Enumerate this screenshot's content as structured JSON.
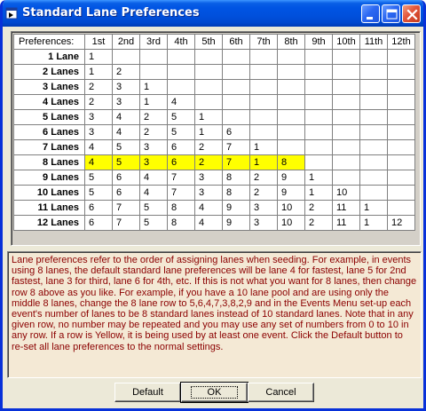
{
  "window": {
    "title": "Standard Lane Preferences",
    "controls": [
      "minimize-icon",
      "maximize-icon",
      "close-icon"
    ]
  },
  "grid": {
    "corner_label": "Preferences:",
    "columns": [
      "1st",
      "2nd",
      "3rd",
      "4th",
      "5th",
      "6th",
      "7th",
      "8th",
      "9th",
      "10th",
      "11th",
      "12th"
    ],
    "highlight_color": "#ffff00",
    "rows": [
      {
        "label": "1 Lane",
        "values": [
          "1"
        ]
      },
      {
        "label": "2 Lanes",
        "values": [
          "1",
          "2"
        ]
      },
      {
        "label": "3 Lanes",
        "values": [
          "2",
          "3",
          "1"
        ]
      },
      {
        "label": "4 Lanes",
        "values": [
          "2",
          "3",
          "1",
          "4"
        ]
      },
      {
        "label": "5 Lanes",
        "values": [
          "3",
          "4",
          "2",
          "5",
          "1"
        ]
      },
      {
        "label": "6 Lanes",
        "values": [
          "3",
          "4",
          "2",
          "5",
          "1",
          "6"
        ]
      },
      {
        "label": "7 Lanes",
        "values": [
          "4",
          "5",
          "3",
          "6",
          "2",
          "7",
          "1"
        ]
      },
      {
        "label": "8 Lanes",
        "values": [
          "4",
          "5",
          "3",
          "6",
          "2",
          "7",
          "1",
          "8"
        ],
        "highlighted": true
      },
      {
        "label": "9 Lanes",
        "values": [
          "5",
          "6",
          "4",
          "7",
          "3",
          "8",
          "2",
          "9",
          "1"
        ]
      },
      {
        "label": "10 Lanes",
        "values": [
          "5",
          "6",
          "4",
          "7",
          "3",
          "8",
          "2",
          "9",
          "1",
          "10"
        ]
      },
      {
        "label": "11 Lanes",
        "values": [
          "6",
          "7",
          "5",
          "8",
          "4",
          "9",
          "3",
          "10",
          "2",
          "11",
          "1"
        ]
      },
      {
        "label": "12 Lanes",
        "values": [
          "6",
          "7",
          "5",
          "8",
          "4",
          "9",
          "3",
          "10",
          "2",
          "11",
          "1",
          "12"
        ]
      }
    ]
  },
  "description": "Lane preferences refer to the order of assigning lanes when seeding.  For example, in events using 8 lanes, the default standard lane preferences will be lane 4 for fastest, lane 5 for 2nd fastest, lane 3 for third, lane 6 for 4th, etc.  If this is not what you want for 8 lanes, then change row 8 above as you like.  For example, if you have a 10 lane pool and are using only the middle 8 lanes, change the 8 lane row to 5,6,4,7,3,8,2,9 and in the Events Menu set-up each event's number of lanes to be 8 standard lanes instead of 10 standard lanes.  Note that in any given row, no number may be repeated and you may use any set of numbers from 0 to 10 in any row.  If a row is Yellow, it is being used by at least one event.  Click the Default button to re-set all lane preferences to the normal settings.",
  "buttons": {
    "default_label": "Default",
    "ok_label": "OK",
    "cancel_label": "Cancel"
  }
}
